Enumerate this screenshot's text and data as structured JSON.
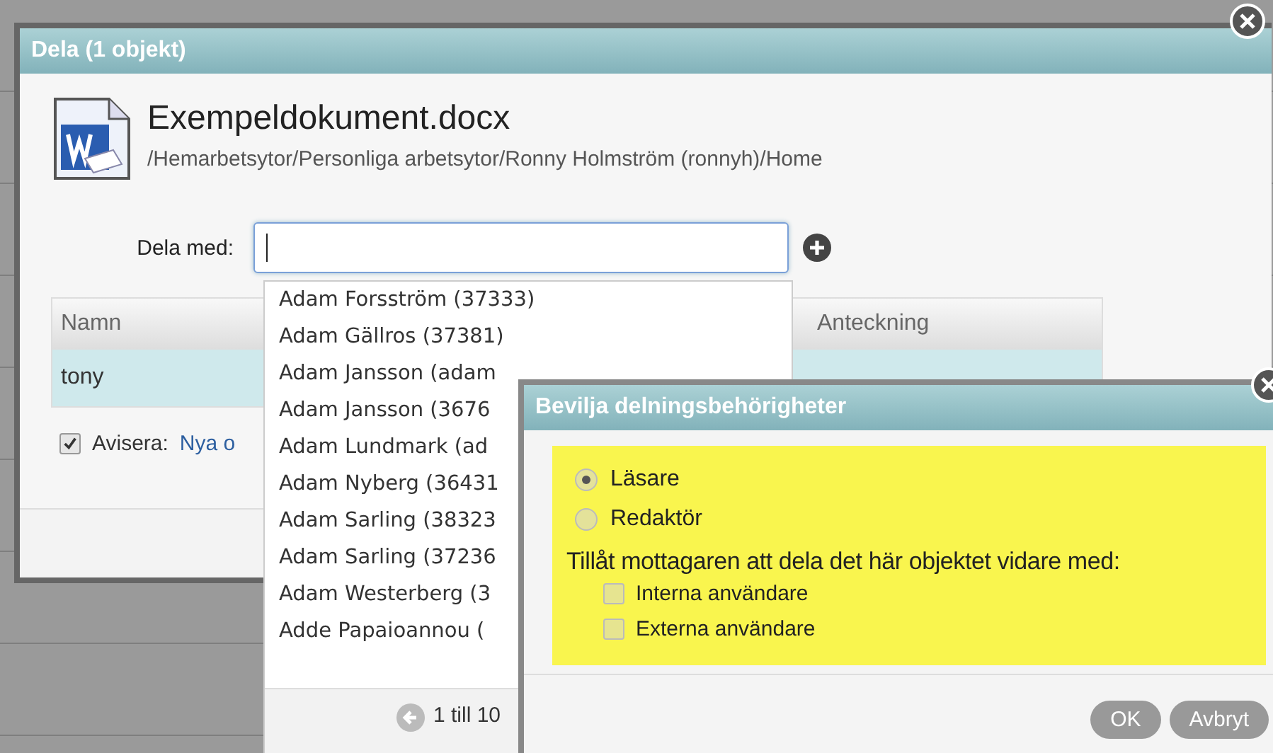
{
  "main_dialog": {
    "title": "Dela (1 objekt)",
    "file": {
      "name": "Exempeldokument.docx",
      "path": "/Hemarbetsytor/Personliga arbetsytor/Ronny Holmström (ronnyh)/Home"
    },
    "share_with": {
      "label": "Dela med:"
    },
    "table": {
      "columns": [
        "Namn",
        "Anteckning"
      ],
      "rows": [
        {
          "cells": [
            "tony"
          ],
          "selected": true
        }
      ]
    },
    "notify": {
      "checked": true,
      "label": "Avisera:",
      "link": "Nya o"
    }
  },
  "dropdown": {
    "items": [
      "Adam Forsström (37333)",
      "Adam Gällros (37381)",
      "Adam Jansson (adam",
      "Adam Jansson (3676",
      "Adam Lundmark (ad",
      "Adam Nyberg (36431",
      "Adam Sarling (38323",
      "Adam Sarling (37236",
      "Adam Westerberg (3",
      "Adde Papaioannou ("
    ],
    "pager": "1 till 10"
  },
  "permission_dialog": {
    "title": "Bevilja delningsbehörigheter",
    "roles": [
      {
        "label": "Läsare",
        "selected": true
      },
      {
        "label": "Redaktör",
        "selected": false
      }
    ],
    "reshare_label": "Tillåt mottagaren att dela det här objektet vidare med:",
    "reshare": [
      {
        "label": "Interna användare",
        "checked": false
      },
      {
        "label": "Externa användare",
        "checked": false
      }
    ],
    "buttons": [
      "OK",
      "Avbryt"
    ]
  }
}
